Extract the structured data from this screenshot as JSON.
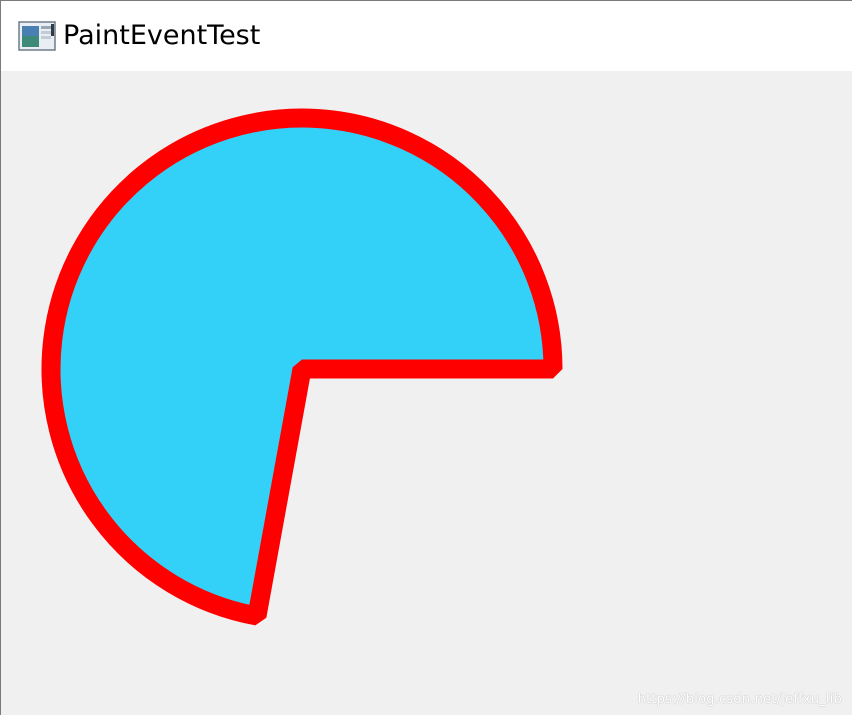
{
  "window": {
    "title": "PaintEventTest",
    "icon": "app-window-icon"
  },
  "canvas": {
    "shape": "pie",
    "fill_color": "#33d1f7",
    "stroke_color": "#ff0000",
    "background": "#f0f0f0"
  },
  "watermark": {
    "text": "https://blog.csdn.net/Jeffxu_lib"
  }
}
